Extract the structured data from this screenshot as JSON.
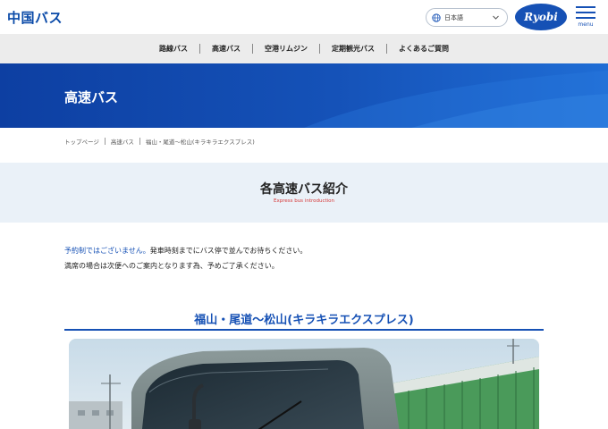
{
  "header": {
    "logo": "中国バス",
    "language": {
      "selected": "日本語"
    },
    "ryobi_logo": "Ryobi",
    "menu_label": "menu"
  },
  "nav": {
    "items": [
      {
        "label": "路線バス"
      },
      {
        "label": "高速バス"
      },
      {
        "label": "空港リムジン"
      },
      {
        "label": "定期観光バス"
      },
      {
        "label": "よくあるご質問"
      }
    ]
  },
  "hero": {
    "title": "高速バス"
  },
  "breadcrumb": {
    "items": [
      {
        "label": "トップページ"
      },
      {
        "label": "高速バス"
      },
      {
        "label": "福山・尾道〜松山(キラキラエクスプレス)"
      }
    ]
  },
  "section": {
    "title": "各高速バス紹介",
    "subtitle": "Express bus introduction"
  },
  "notice": {
    "highlight": "予約制ではございません。",
    "line1_rest": "発車時刻までにバス停で並んでお待ちください。",
    "line2": "満席の場合は次便へのご案内となります為、予めご了承ください。"
  },
  "route": {
    "title": "福山・尾道〜松山(キラキラエクスプレス)"
  },
  "colors": {
    "brand_blue": "#1651b5",
    "nav_bg": "#ececec",
    "section_bg": "#eaf1f8",
    "subtitle_red": "#d63a3a"
  }
}
